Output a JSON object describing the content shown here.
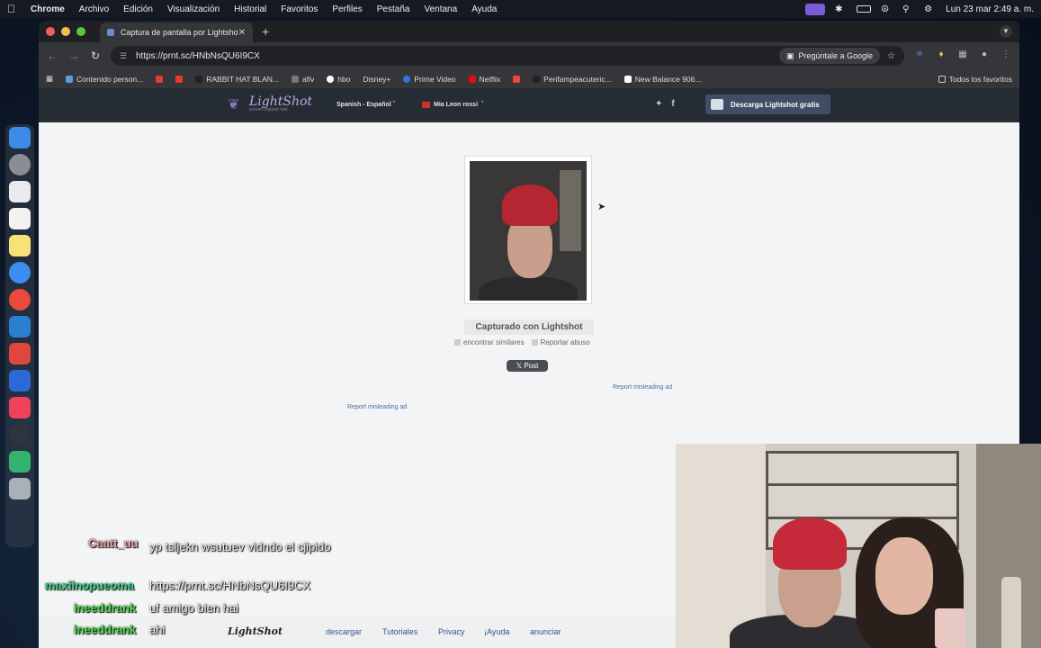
{
  "menubar": {
    "items": [
      "Chrome",
      "Archivo",
      "Edición",
      "Visualización",
      "Historial",
      "Favoritos",
      "Perfiles",
      "Pestaña",
      "Ventana",
      "Ayuda"
    ],
    "clock": "Lun 23 mar  2:49 a. m."
  },
  "browser": {
    "tab_title": "Captura de pantalla por Lightshot",
    "url": "https://prnt.sc/HNbNsQU6I9CX",
    "google_pill": "Pregúntale a Google",
    "bookmarks": [
      "Contenido person...",
      "RABBIT HAT BLAN...",
      "afiv",
      "hbo",
      "Disney+",
      "Prime Video",
      "Netflix",
      "Perifampeacuteric...",
      "New Balance 906..."
    ],
    "all_bookmarks": "Todos los favoritos"
  },
  "lightshot": {
    "brand": "LightShot",
    "tagline": "screen capture tool",
    "language": "Spanish - Español",
    "user": "Mia Leon rossi",
    "download_button": "Descarga Lightshot gratis",
    "captured_label": "Capturado con Lightshot",
    "find_similar": "encontrar similares",
    "report_abuse": "Reportar abuso",
    "post_button": "𝕏 Post",
    "report_ad_1": "Report misleading ad",
    "report_ad_2": "Report misleading ad",
    "footer": {
      "logo": "LightShot",
      "links": [
        "descargar",
        "Tutoriales",
        "Privacy",
        "¡Ayuda",
        "anunciar"
      ]
    }
  },
  "chat": [
    {
      "user": "Caatt_uu",
      "user_color": "#e8a0a0",
      "message": "yp tsljekn wsutuev vidndo el cjipido"
    },
    {
      "user": "maxiinopueoma",
      "user_color": "#3ad28a",
      "message": "https://prnt.sc/HNbNsQU6I9CX"
    },
    {
      "user": "ineeddrank",
      "user_color": "#4ddc4d",
      "message": "uf amigo bien hai"
    },
    {
      "user": "ineeddrank",
      "user_color": "#4ddc4d",
      "message": "ahi"
    }
  ]
}
